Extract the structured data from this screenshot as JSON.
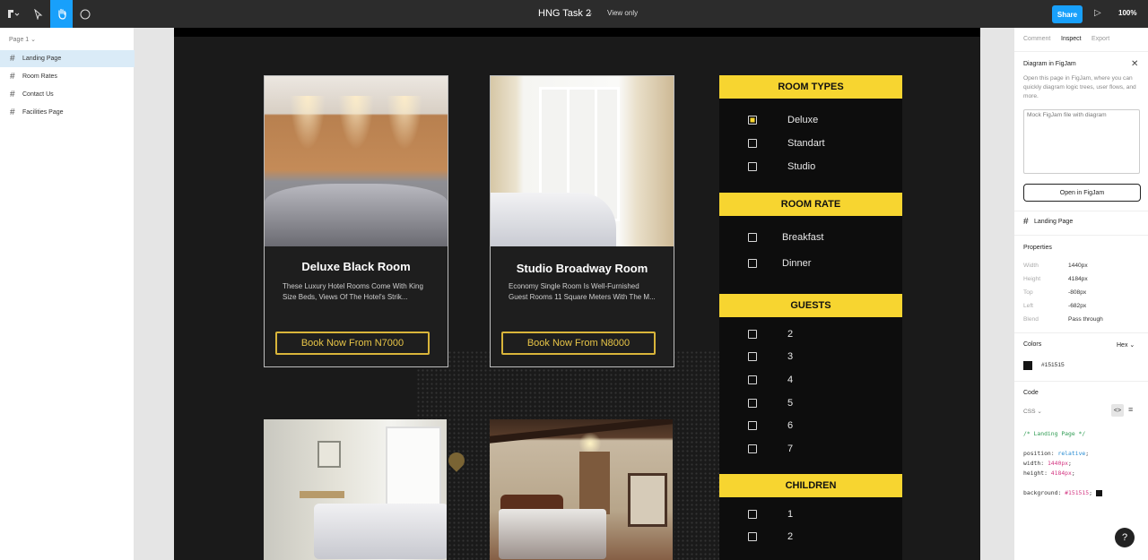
{
  "toolbar": {
    "file_title": "HNG Task 2",
    "view_only": "View only",
    "share_label": "Share",
    "zoom": "100%",
    "icons": [
      "figma-menu-icon",
      "move-tool-icon",
      "hand-tool-icon",
      "comment-icon",
      "play-icon"
    ]
  },
  "left_panel": {
    "page_selector": "Page 1",
    "layers": [
      {
        "label": "Landing Page",
        "active": true
      },
      {
        "label": "Room Rates",
        "active": false
      },
      {
        "label": "Contact Us",
        "active": false
      },
      {
        "label": "Facilities Page",
        "active": false
      }
    ]
  },
  "design": {
    "cards": [
      {
        "title": "Deluxe Black Room",
        "desc": "These Luxury Hotel Rooms Come With King Size Beds, Views Of The Hotel's Strik...",
        "button": "Book Now From N7000"
      },
      {
        "title": "Studio Broadway Room",
        "desc": "Economy Single Room Is Well-Furnished Guest Rooms 11 Square Meters With The M...",
        "button": "Book Now From N8000"
      }
    ],
    "filters": {
      "room_types": {
        "title": "ROOM TYPES",
        "options": [
          {
            "label": "Deluxe",
            "checked": true
          },
          {
            "label": "Standart",
            "checked": false
          },
          {
            "label": "Studio",
            "checked": false
          }
        ]
      },
      "room_rate": {
        "title": "ROOM RATE",
        "options": [
          {
            "label": "Breakfast",
            "checked": false
          },
          {
            "label": "Dinner",
            "checked": false
          }
        ]
      },
      "guests": {
        "title": "GUESTS",
        "options": [
          "2",
          "3",
          "4",
          "5",
          "6",
          "7"
        ]
      },
      "children": {
        "title": "CHILDREN",
        "options": [
          "1",
          "2"
        ]
      }
    },
    "accent_color": "#f7d530"
  },
  "right_panel": {
    "tabs": [
      "Comment",
      "Inspect",
      "Export"
    ],
    "active_tab": "Inspect",
    "figjam": {
      "title": "Diagram in FigJam",
      "desc": "Open this page in FigJam, where you can quickly diagram logic trees, user flows, and more.",
      "image_alt": "Mock FigJam file with diagram",
      "button": "Open in FigJam"
    },
    "selection": "Landing Page",
    "properties_title": "Properties",
    "properties": [
      {
        "k": "Width",
        "v": "1440px"
      },
      {
        "k": "Height",
        "v": "4184px"
      },
      {
        "k": "Top",
        "v": "-808px"
      },
      {
        "k": "Left",
        "v": "-682px"
      },
      {
        "k": "Blend",
        "v": "Pass through"
      }
    ],
    "colors_title": "Colors",
    "color_format": "Hex",
    "color_value": "#151515",
    "code_title": "Code",
    "code_lang": "CSS",
    "code": {
      "comment": "/* Landing Page */",
      "l1k": "position: ",
      "l1v": "relative",
      "l1e": ";",
      "l2k": "width: ",
      "l2v": "1440px",
      "l2e": ";",
      "l3k": "height: ",
      "l3v": "4184px",
      "l3e": ";",
      "l4k": "background: ",
      "l4v": "#151515",
      "l4e": ";"
    },
    "help": "?"
  }
}
